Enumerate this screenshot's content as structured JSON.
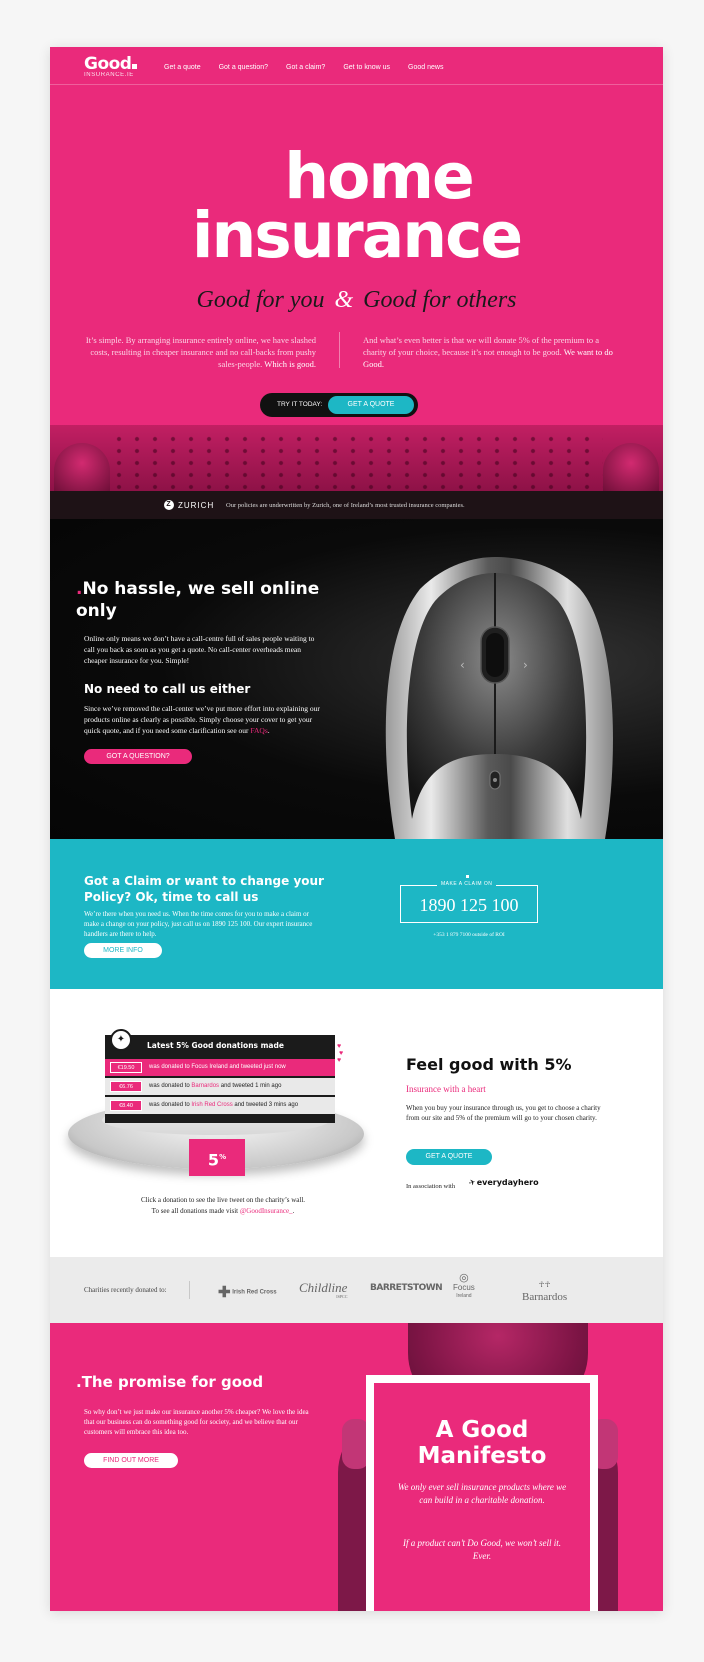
{
  "colors": {
    "pink": "#ea2a7b",
    "teal": "#1db7c5",
    "black": "#0a0a0a"
  },
  "nav": {
    "logo": "Good",
    "logo_sub": "INSURANCE.IE",
    "links": [
      "Get a quote",
      "Got a question?",
      "Got a claim?",
      "Get to know us",
      "Good news"
    ]
  },
  "hero": {
    "title_line1": "home",
    "title_line2": "insurance",
    "tag_left": "Good for you",
    "tag_amp": "&",
    "tag_right": "Good for others",
    "intro_left": "It’s simple. By arranging insurance entirely online, we have slashed costs, resulting in cheaper insurance and no call-backs from pushy sales-people.",
    "intro_left_strong": "Which is good.",
    "intro_right": "And what’s even better is that we will donate 5% of the premium to a charity of your choice, because it’s not enough to be good.",
    "intro_right_strong": "We want to do Good.",
    "try_label": "TRY IT TODAY:",
    "quote_button": "GET A QUOTE"
  },
  "zurich": {
    "logo": "ZURICH",
    "text": "Our policies are underwritten by Zurich, one of Ireland’s most trusted insurance companies."
  },
  "online": {
    "dot": ".",
    "heading": "No hassle, we sell online only",
    "body": "Online only means we don’t have a call-centre full of sales people waiting to call you back as soon as you get a quote. No call-center overheads mean cheaper insurance for you. Simple!",
    "subheading": "No need to call us either",
    "body2": "Since we’ve removed the call-center we’ve put more effort into explaining our products online as clearly as possible. Simply choose your cover to get your quick quote, and if you need some clarification see our",
    "faq_link": "FAQs",
    "body2_end": ".",
    "button": "GOT A QUESTION?"
  },
  "claim": {
    "heading": "Got a Claim or want to change your Policy? Ok, time to call us",
    "body": "We’re there when you need us. When the time comes for you to make a claim or make a change on your policy, just call us on 1890 125 100. Our expert insurance handlers are there to help.",
    "button": "MORE INFO",
    "box_label": "MAKE A CLAIM ON",
    "number": "1890 125 100",
    "alt_number": "+353 1 879 7100 outside of ROI"
  },
  "donations": {
    "screen_title": "Latest 5% Good donations made",
    "rows": [
      {
        "amount": "€19.50",
        "pre": "was donated to Focus Ireland and tweeted just now",
        "charity": "",
        "post": ""
      },
      {
        "amount": "€6.76",
        "pre": "was donated to ",
        "charity": "Barnardos",
        "post": " and tweeted 1 min ago"
      },
      {
        "amount": "€8.40",
        "pre": "was donated to ",
        "charity": "Irish Red Cross",
        "post": " and tweeted 3 mins ago"
      }
    ],
    "five": "5",
    "five_sup": "%",
    "note1": "Click a donation to see the live tweet on the charity’s wall.",
    "note2": "To see all donations made visit",
    "handle": "@GoodInsurance_",
    "note_end": ".",
    "heading": "Feel good with 5%",
    "subheading": "Insurance with a heart",
    "body": "When you buy your insurance through us, you get to choose a charity from our site and 5% of the premium will go to your chosen charity.",
    "button": "GET A QUOTE",
    "assoc_label": "In association with",
    "assoc_logo": "everydayhero"
  },
  "charities": {
    "label": "Charities recently donated to:",
    "logos": [
      "Irish Red Cross",
      "Childline",
      "ISPCC",
      "BARRETSTOWN",
      "Focus",
      "Ireland",
      "Barnardos"
    ]
  },
  "promise": {
    "dot": ".",
    "heading": "The promise for good",
    "body": "So why don’t we just make our insurance another 5% cheaper? We love the idea that our business can do something good for society, and we believe that our customers will embrace this idea too.",
    "button": "FIND OUT MORE",
    "manifesto_title": "A Good Manifesto",
    "manifesto_p1": "We only ever sell insurance products where we can build in a charitable donation.",
    "manifesto_p2": "If a product can’t Do Good, we won’t sell it. Ever."
  }
}
